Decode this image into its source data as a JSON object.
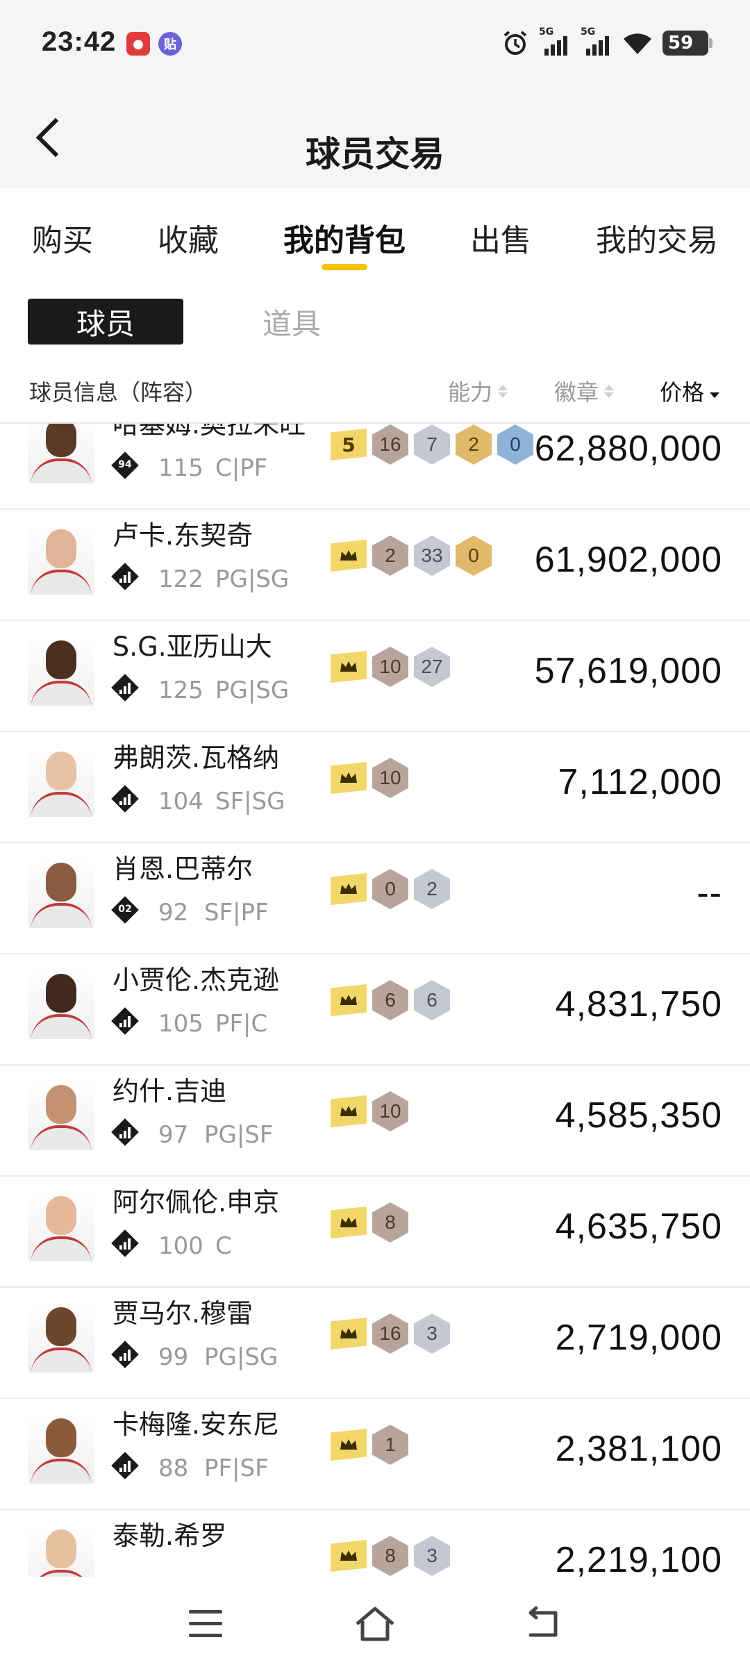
{
  "status": {
    "time": "23:42",
    "app1": "●",
    "app2": "贴",
    "sig1": "5G",
    "sig2": "5G",
    "battery": "59"
  },
  "header": {
    "title": "球员交易"
  },
  "tabs": [
    {
      "label": "购买"
    },
    {
      "label": "收藏"
    },
    {
      "label": "我的背包"
    },
    {
      "label": "出售"
    },
    {
      "label": "我的交易"
    }
  ],
  "subtabs": {
    "players": "球员",
    "items": "道具"
  },
  "columns": {
    "info": "球员信息（阵容）",
    "ability": "能力",
    "badge": "徽章",
    "price": "价格"
  },
  "players": [
    {
      "name": "哈基姆.奥拉朱旺",
      "rating_icon": "94",
      "ovr": "115",
      "pos": "C|PF",
      "badges": [
        "5",
        "16",
        "7",
        "2",
        "0"
      ],
      "price": "62,880,000"
    },
    {
      "name": "卢卡.东契奇",
      "rating_icon": "bars",
      "ovr": "122",
      "pos": "PG|SG",
      "badges": [
        "crown",
        "2",
        "33",
        "0"
      ],
      "price": "61,902,000"
    },
    {
      "name": "S.G.亚历山大",
      "rating_icon": "bars",
      "ovr": "125",
      "pos": "PG|SG",
      "badges": [
        "crown",
        "10",
        "27"
      ],
      "price": "57,619,000"
    },
    {
      "name": "弗朗茨.瓦格纳",
      "rating_icon": "bars",
      "ovr": "104",
      "pos": "SF|SG",
      "badges": [
        "crown",
        "10"
      ],
      "price": "7,112,000"
    },
    {
      "name": "肖恩.巴蒂尔",
      "rating_icon": "02",
      "ovr": "92",
      "pos": "SF|PF",
      "badges": [
        "crown",
        "0",
        "2"
      ],
      "price": "--"
    },
    {
      "name": "小贾伦.杰克逊",
      "rating_icon": "bars",
      "ovr": "105",
      "pos": "PF|C",
      "badges": [
        "crown",
        "6",
        "6"
      ],
      "price": "4,831,750"
    },
    {
      "name": "约什.吉迪",
      "rating_icon": "bars",
      "ovr": "97",
      "pos": "PG|SF",
      "badges": [
        "crown",
        "10"
      ],
      "price": "4,585,350"
    },
    {
      "name": "阿尔佩伦.申京",
      "rating_icon": "bars",
      "ovr": "100",
      "pos": "C",
      "badges": [
        "crown",
        "8"
      ],
      "price": "4,635,750"
    },
    {
      "name": "贾马尔.穆雷",
      "rating_icon": "bars",
      "ovr": "99",
      "pos": "PG|SG",
      "badges": [
        "crown",
        "16",
        "3"
      ],
      "price": "2,719,000"
    },
    {
      "name": "卡梅隆.安东尼",
      "rating_icon": "bars",
      "ovr": "88",
      "pos": "PF|SF",
      "badges": [
        "crown",
        "1"
      ],
      "price": "2,381,100"
    },
    {
      "name": "泰勒.希罗",
      "rating_icon": "bars",
      "ovr": "",
      "pos": "",
      "badges": [
        "crown",
        "8",
        "3"
      ],
      "price": "2,219,100"
    }
  ]
}
